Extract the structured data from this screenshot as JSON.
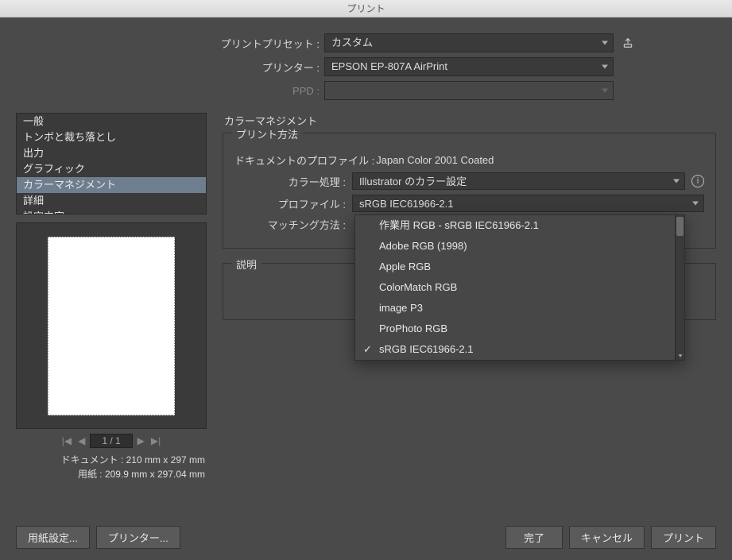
{
  "window": {
    "title": "プリント"
  },
  "top": {
    "preset_label": "プリントプリセット :",
    "preset_value": "カスタム",
    "printer_label": "プリンター :",
    "printer_value": "EPSON EP-807A AirPrint",
    "ppd_label": "PPD :",
    "ppd_value": ""
  },
  "categories": {
    "items": [
      "一般",
      "トンボと裁ち落とし",
      "出力",
      "グラフィック",
      "カラーマネジメント",
      "詳細",
      "設定内容"
    ],
    "selected_index": 4
  },
  "section_title": "カラーマネジメント",
  "print_method": {
    "legend": "プリント方法",
    "doc_profile_label": "ドキュメントのプロファイル :",
    "doc_profile_value": "Japan Color 2001 Coated",
    "color_handling_label": "カラー処理 :",
    "color_handling_value": "Illustrator のカラー設定",
    "profile_label": "プロファイル :",
    "profile_value": "sRGB IEC61966-2.1",
    "intent_label": "マッチング方法 :",
    "intent_value": ""
  },
  "profile_options": [
    {
      "label": "作業用 RGB - sRGB IEC61966-2.1",
      "checked": false
    },
    {
      "label": "Adobe RGB (1998)",
      "checked": false
    },
    {
      "label": "Apple RGB",
      "checked": false
    },
    {
      "label": "ColorMatch RGB",
      "checked": false
    },
    {
      "label": "image P3",
      "checked": false
    },
    {
      "label": "ProPhoto RGB",
      "checked": false
    },
    {
      "label": "sRGB IEC61966-2.1",
      "checked": true
    }
  ],
  "explain": {
    "legend": "説明"
  },
  "pager": {
    "text": "1 / 1"
  },
  "dims": {
    "doc": "ドキュメント : 210 mm x 297 mm",
    "paper": "用紙 : 209.9 mm x 297.04 mm"
  },
  "footer": {
    "page_setup": "用紙設定...",
    "printer_btn": "プリンター...",
    "done": "完了",
    "cancel": "キャンセル",
    "print": "プリント"
  }
}
